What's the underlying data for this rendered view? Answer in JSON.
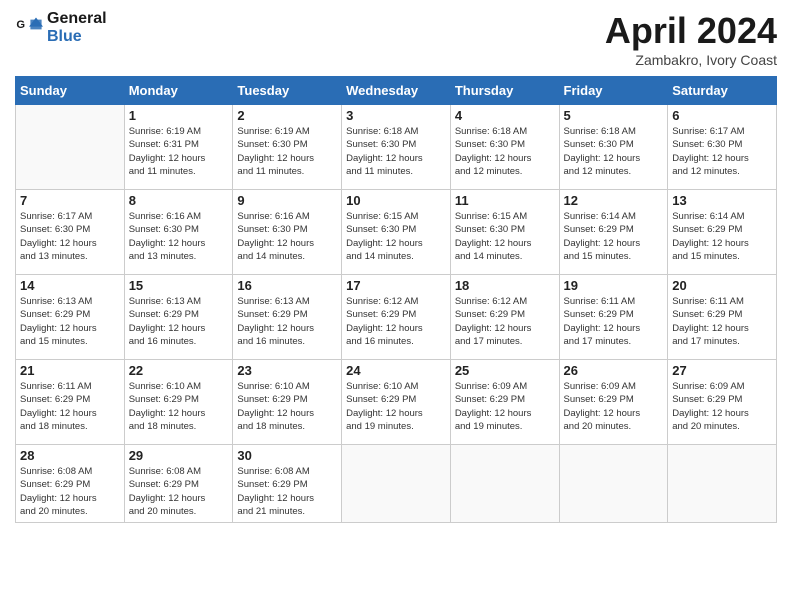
{
  "header": {
    "logo_line1": "General",
    "logo_line2": "Blue",
    "month_title": "April 2024",
    "location": "Zambakro, Ivory Coast"
  },
  "days_of_week": [
    "Sunday",
    "Monday",
    "Tuesday",
    "Wednesday",
    "Thursday",
    "Friday",
    "Saturday"
  ],
  "weeks": [
    [
      {
        "day": "",
        "info": ""
      },
      {
        "day": "1",
        "info": "Sunrise: 6:19 AM\nSunset: 6:31 PM\nDaylight: 12 hours\nand 11 minutes."
      },
      {
        "day": "2",
        "info": "Sunrise: 6:19 AM\nSunset: 6:30 PM\nDaylight: 12 hours\nand 11 minutes."
      },
      {
        "day": "3",
        "info": "Sunrise: 6:18 AM\nSunset: 6:30 PM\nDaylight: 12 hours\nand 11 minutes."
      },
      {
        "day": "4",
        "info": "Sunrise: 6:18 AM\nSunset: 6:30 PM\nDaylight: 12 hours\nand 12 minutes."
      },
      {
        "day": "5",
        "info": "Sunrise: 6:18 AM\nSunset: 6:30 PM\nDaylight: 12 hours\nand 12 minutes."
      },
      {
        "day": "6",
        "info": "Sunrise: 6:17 AM\nSunset: 6:30 PM\nDaylight: 12 hours\nand 12 minutes."
      }
    ],
    [
      {
        "day": "7",
        "info": "Sunrise: 6:17 AM\nSunset: 6:30 PM\nDaylight: 12 hours\nand 13 minutes."
      },
      {
        "day": "8",
        "info": "Sunrise: 6:16 AM\nSunset: 6:30 PM\nDaylight: 12 hours\nand 13 minutes."
      },
      {
        "day": "9",
        "info": "Sunrise: 6:16 AM\nSunset: 6:30 PM\nDaylight: 12 hours\nand 14 minutes."
      },
      {
        "day": "10",
        "info": "Sunrise: 6:15 AM\nSunset: 6:30 PM\nDaylight: 12 hours\nand 14 minutes."
      },
      {
        "day": "11",
        "info": "Sunrise: 6:15 AM\nSunset: 6:30 PM\nDaylight: 12 hours\nand 14 minutes."
      },
      {
        "day": "12",
        "info": "Sunrise: 6:14 AM\nSunset: 6:29 PM\nDaylight: 12 hours\nand 15 minutes."
      },
      {
        "day": "13",
        "info": "Sunrise: 6:14 AM\nSunset: 6:29 PM\nDaylight: 12 hours\nand 15 minutes."
      }
    ],
    [
      {
        "day": "14",
        "info": "Sunrise: 6:13 AM\nSunset: 6:29 PM\nDaylight: 12 hours\nand 15 minutes."
      },
      {
        "day": "15",
        "info": "Sunrise: 6:13 AM\nSunset: 6:29 PM\nDaylight: 12 hours\nand 16 minutes."
      },
      {
        "day": "16",
        "info": "Sunrise: 6:13 AM\nSunset: 6:29 PM\nDaylight: 12 hours\nand 16 minutes."
      },
      {
        "day": "17",
        "info": "Sunrise: 6:12 AM\nSunset: 6:29 PM\nDaylight: 12 hours\nand 16 minutes."
      },
      {
        "day": "18",
        "info": "Sunrise: 6:12 AM\nSunset: 6:29 PM\nDaylight: 12 hours\nand 17 minutes."
      },
      {
        "day": "19",
        "info": "Sunrise: 6:11 AM\nSunset: 6:29 PM\nDaylight: 12 hours\nand 17 minutes."
      },
      {
        "day": "20",
        "info": "Sunrise: 6:11 AM\nSunset: 6:29 PM\nDaylight: 12 hours\nand 17 minutes."
      }
    ],
    [
      {
        "day": "21",
        "info": "Sunrise: 6:11 AM\nSunset: 6:29 PM\nDaylight: 12 hours\nand 18 minutes."
      },
      {
        "day": "22",
        "info": "Sunrise: 6:10 AM\nSunset: 6:29 PM\nDaylight: 12 hours\nand 18 minutes."
      },
      {
        "day": "23",
        "info": "Sunrise: 6:10 AM\nSunset: 6:29 PM\nDaylight: 12 hours\nand 18 minutes."
      },
      {
        "day": "24",
        "info": "Sunrise: 6:10 AM\nSunset: 6:29 PM\nDaylight: 12 hours\nand 19 minutes."
      },
      {
        "day": "25",
        "info": "Sunrise: 6:09 AM\nSunset: 6:29 PM\nDaylight: 12 hours\nand 19 minutes."
      },
      {
        "day": "26",
        "info": "Sunrise: 6:09 AM\nSunset: 6:29 PM\nDaylight: 12 hours\nand 20 minutes."
      },
      {
        "day": "27",
        "info": "Sunrise: 6:09 AM\nSunset: 6:29 PM\nDaylight: 12 hours\nand 20 minutes."
      }
    ],
    [
      {
        "day": "28",
        "info": "Sunrise: 6:08 AM\nSunset: 6:29 PM\nDaylight: 12 hours\nand 20 minutes."
      },
      {
        "day": "29",
        "info": "Sunrise: 6:08 AM\nSunset: 6:29 PM\nDaylight: 12 hours\nand 20 minutes."
      },
      {
        "day": "30",
        "info": "Sunrise: 6:08 AM\nSunset: 6:29 PM\nDaylight: 12 hours\nand 21 minutes."
      },
      {
        "day": "",
        "info": ""
      },
      {
        "day": "",
        "info": ""
      },
      {
        "day": "",
        "info": ""
      },
      {
        "day": "",
        "info": ""
      }
    ]
  ]
}
